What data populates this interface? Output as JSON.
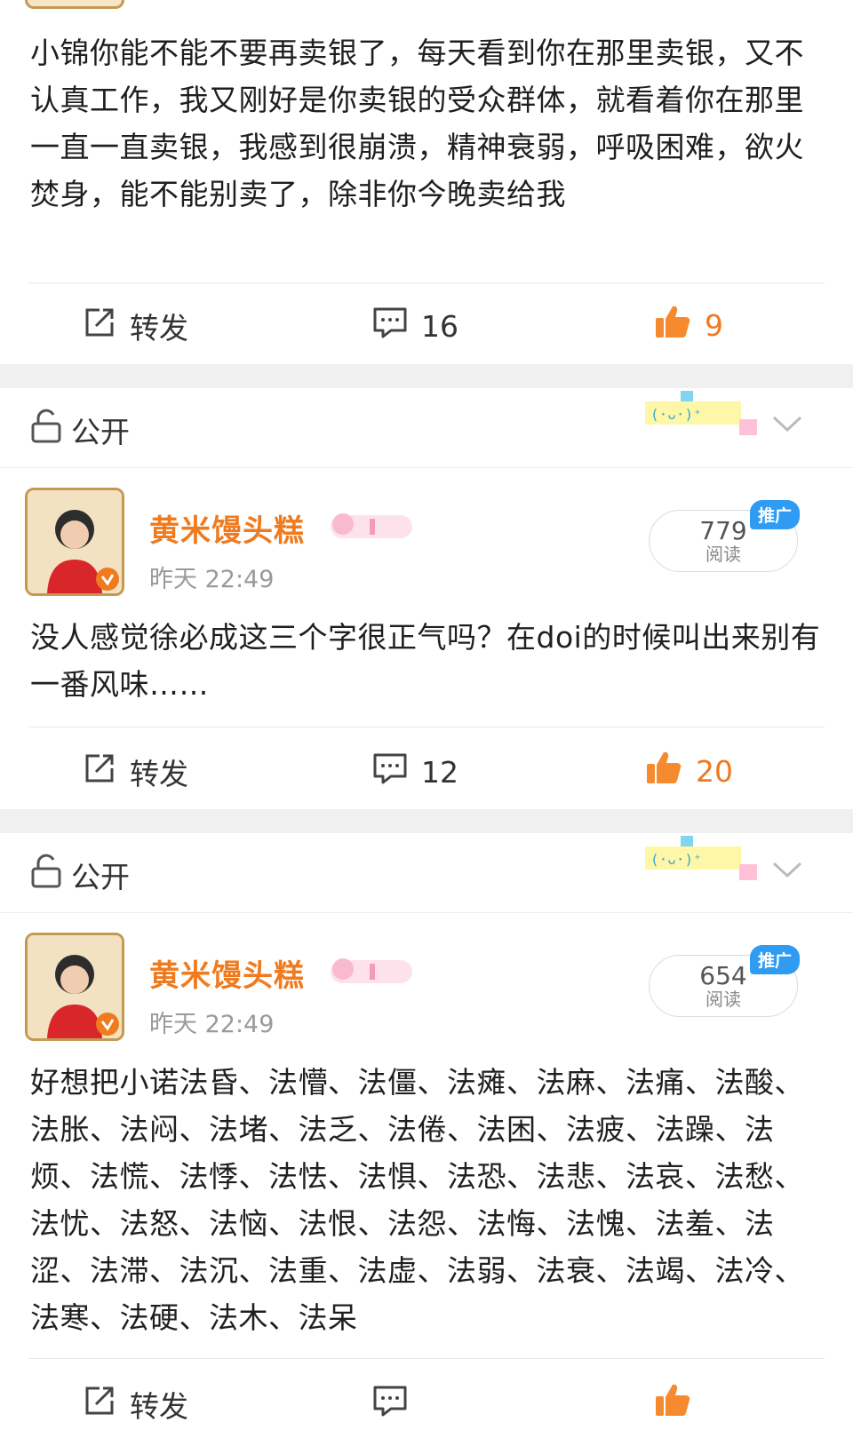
{
  "posts": [
    {
      "text": "小锦你能不能不要再卖银了，每天看到你在那里卖银，又不认真工作，我又刚好是你卖银的受众群体，就看着你在那里一直一直卖银，我感到很崩溃，精神衰弱，呼吸困难，欲火焚身，能不能别卖了，除非你今晚卖给我",
      "actions": {
        "repost_label": "转发",
        "comments": "16",
        "likes": "9"
      }
    },
    {
      "visibility": "公开",
      "author": "黄米馒头糕",
      "time": "昨天 22:49",
      "reads": "779",
      "reads_label": "阅读",
      "promo_label": "推广",
      "text": "没人感觉徐必成这三个字很正气吗？在doi的时候叫出来别有一番风味……",
      "actions": {
        "repost_label": "转发",
        "comments": "12",
        "likes": "20"
      }
    },
    {
      "visibility": "公开",
      "author": "黄米馒头糕",
      "time": "昨天 22:49",
      "reads": "654",
      "reads_label": "阅读",
      "promo_label": "推广",
      "text": "好想把小诺法昏、法懵、法僵、法瘫、法麻、法痛、法酸、法胀、法闷、法堵、法乏、法倦、法困、法疲、法躁、法烦、法慌、法悸、法怯、法惧、法恐、法悲、法哀、法愁、法忧、法怒、法恼、法恨、法怨、法悔、法愧、法羞、法涩、法滞、法沉、法重、法虚、法弱、法衰、法竭、法冷、法寒、法硬、法木、法呆",
      "actions": {
        "repost_label": "转发",
        "comments": "",
        "likes": ""
      }
    }
  ],
  "colors": {
    "accent": "#f07a1e",
    "promo": "#2f9bf2",
    "separator": "#f0f0f0"
  }
}
